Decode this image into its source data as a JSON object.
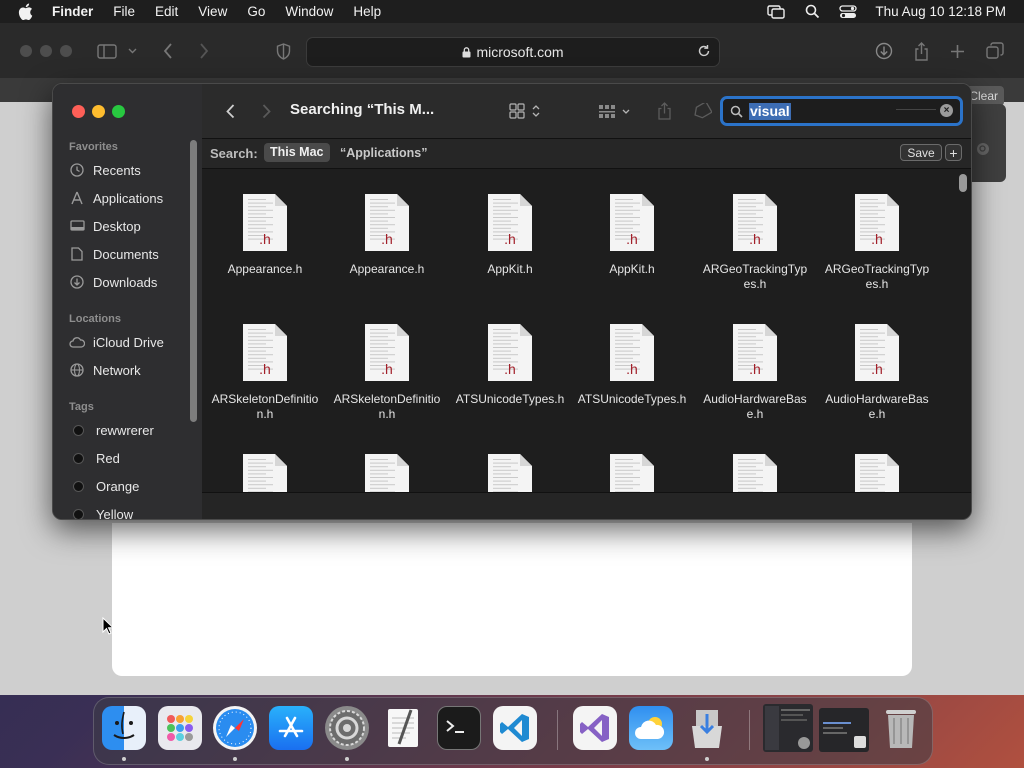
{
  "menubar": {
    "app_name": "Finder",
    "menus": [
      "File",
      "Edit",
      "View",
      "Go",
      "Window",
      "Help"
    ],
    "clock": "Thu Aug 10  12:18 PM"
  },
  "safari": {
    "url": "microsoft.com",
    "clear_label": "Clear"
  },
  "finder": {
    "title": "Searching “This M...",
    "search_value": "visual",
    "sidebar": {
      "favorites_header": "Favorites",
      "favorites": [
        {
          "label": "Recents",
          "icon": "clock-icon"
        },
        {
          "label": "Applications",
          "icon": "applications-icon"
        },
        {
          "label": "Desktop",
          "icon": "desktop-icon"
        },
        {
          "label": "Documents",
          "icon": "document-icon"
        },
        {
          "label": "Downloads",
          "icon": "download-icon"
        }
      ],
      "locations_header": "Locations",
      "locations": [
        {
          "label": "iCloud Drive",
          "icon": "cloud-icon"
        },
        {
          "label": "Network",
          "icon": "network-icon"
        }
      ],
      "tags_header": "Tags",
      "tags": [
        {
          "label": "rewwrerer"
        },
        {
          "label": "Red"
        },
        {
          "label": "Orange"
        },
        {
          "label": "Yellow"
        }
      ]
    },
    "scope": {
      "label": "Search:",
      "this_mac": "This Mac",
      "applications": "“Applications”",
      "save": "Save",
      "add": "+"
    },
    "files": [
      {
        "name": "Appearance.h",
        "badge": ".h"
      },
      {
        "name": "Appearance.h",
        "badge": ".h"
      },
      {
        "name": "AppKit.h",
        "badge": ".h"
      },
      {
        "name": "AppKit.h",
        "badge": ".h"
      },
      {
        "name": "ARGeoTrackingTypes.h",
        "badge": ".h"
      },
      {
        "name": "ARGeoTrackingTypes.h",
        "badge": ".h"
      },
      {
        "name": "ARSkeletonDefinition.h",
        "badge": ".h"
      },
      {
        "name": "ARSkeletonDefinition.h",
        "badge": ".h"
      },
      {
        "name": "ATSUnicodeTypes.h",
        "badge": ".h"
      },
      {
        "name": "ATSUnicodeTypes.h",
        "badge": ".h"
      },
      {
        "name": "AudioHardwareBase.h",
        "badge": ".h"
      },
      {
        "name": "AudioHardwareBase.h",
        "badge": ".h"
      },
      {
        "name": "",
        "badge": ""
      },
      {
        "name": "",
        "badge": ""
      },
      {
        "name": "",
        "badge": ""
      },
      {
        "name": "",
        "badge": ""
      },
      {
        "name": "",
        "badge": ""
      },
      {
        "name": "",
        "badge": ""
      }
    ]
  },
  "dock": {
    "apps": [
      {
        "name": "Finder",
        "icon": "finder-icon",
        "running": true
      },
      {
        "name": "Launchpad",
        "icon": "launchpad-icon",
        "running": false
      },
      {
        "name": "Safari",
        "icon": "safari-icon",
        "running": true
      },
      {
        "name": "App Store",
        "icon": "app-store-icon",
        "running": false
      },
      {
        "name": "System Settings",
        "icon": "system-settings-icon",
        "running": true
      },
      {
        "name": "TextEdit",
        "icon": "textedit-icon",
        "running": false
      },
      {
        "name": "Terminal",
        "icon": "terminal-icon",
        "running": false
      },
      {
        "name": "Visual Studio Code",
        "icon": "vscode-icon",
        "running": false
      },
      {
        "name": "Visual Studio",
        "icon": "visual-studio-icon",
        "running": false
      },
      {
        "name": "Weather",
        "icon": "weather-icon",
        "running": false
      },
      {
        "name": "Installer",
        "icon": "installer-icon",
        "running": true
      },
      {
        "name": "Minimized Window 1",
        "icon": "window-thumbnail-icon",
        "running": false
      },
      {
        "name": "Minimized Window 2",
        "icon": "window-thumbnail-icon",
        "running": false
      },
      {
        "name": "Trash",
        "icon": "trash-icon",
        "running": false
      }
    ]
  }
}
